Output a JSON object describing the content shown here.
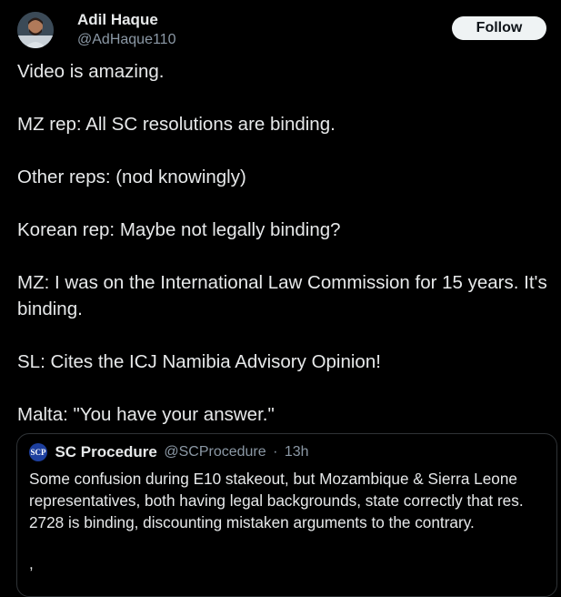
{
  "tweet": {
    "author_name": "Adil Haque",
    "author_handle": "@AdHaque110",
    "follow_label": "Follow",
    "paragraphs": [
      "Video is amazing.",
      "MZ rep: All SC resolutions are binding.",
      "Other reps: (nod knowingly)",
      "Korean rep: Maybe not legally binding?",
      "MZ: I was on the International Law Commission for 15 years. It's binding.",
      "SL: Cites the ICJ Namibia Advisory Opinion!",
      "Malta: \"You have your answer.\""
    ]
  },
  "quoted_tweet": {
    "avatar_text": "SCP",
    "author_name": "SC Procedure",
    "author_handle": "@SCProcedure",
    "separator": "·",
    "time": "13h",
    "text": "Some confusion during E10 stakeout, but Mozambique & Sierra Leone representatives, both having legal backgrounds, state correctly that res. 2728 is binding, discounting mistaken arguments to the contrary.",
    "trailing": ","
  },
  "colors": {
    "background": "#000000",
    "text_primary": "#e7e9ea",
    "text_secondary": "#8b98a5",
    "border": "#2f3336",
    "follow_bg": "#eff3f4",
    "quote_avatar_bg": "#1d3f9e"
  },
  "icons": {
    "author_avatar": "person-avatar",
    "quote_avatar": "scp-logo"
  }
}
